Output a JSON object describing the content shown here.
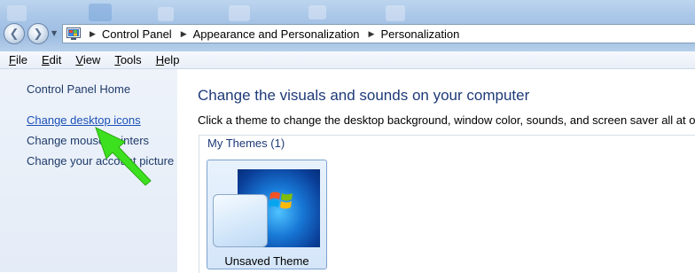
{
  "window": {
    "back_glyph": "❮",
    "forward_glyph": "❯",
    "dropdown_glyph": "▼",
    "breadcrumb": [
      "Control Panel",
      "Appearance and Personalization",
      "Personalization"
    ],
    "breadcrumb_separator": "▶"
  },
  "menu": [
    "File",
    "Edit",
    "View",
    "Tools",
    "Help"
  ],
  "sidebar": {
    "home": "Control Panel Home",
    "links": [
      "Change desktop icons",
      "Change mouse pointers",
      "Change your account picture"
    ]
  },
  "main": {
    "title": "Change the visuals and sounds on your computer",
    "description": "Click a theme to change the desktop background, window color, sounds, and screen saver all at once.",
    "group_label": "My Themes (1)",
    "themes": [
      {
        "name": "Unsaved Theme"
      }
    ]
  },
  "colors": {
    "link": "#1a50b8",
    "heading": "#1e3a78",
    "annotation_arrow": "#3de01f"
  },
  "icons": [
    "back-icon",
    "forward-icon",
    "control-panel-icon",
    "windows-logo-icon",
    "green-arrow-annotation"
  ]
}
